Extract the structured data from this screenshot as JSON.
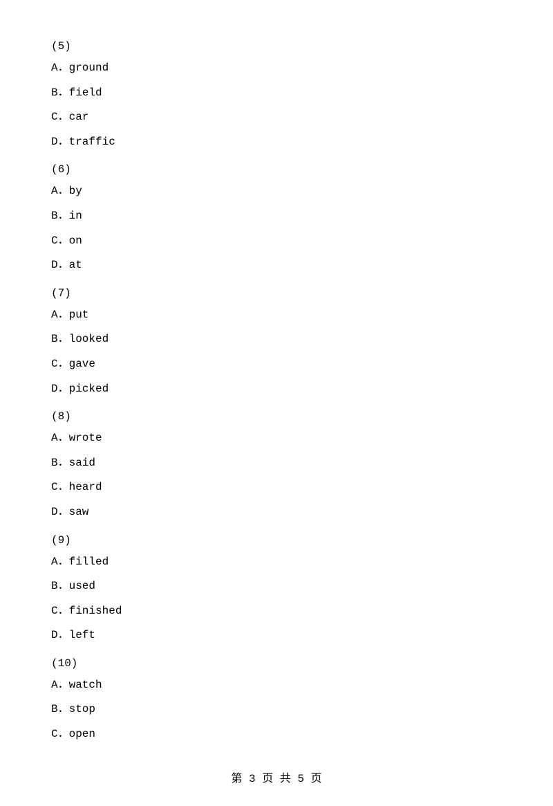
{
  "questions": [
    {
      "number": "(5)",
      "options": [
        {
          "label": "A．ground"
        },
        {
          "label": "B．field"
        },
        {
          "label": "C．car"
        },
        {
          "label": "D．traffic"
        }
      ]
    },
    {
      "number": "(6)",
      "options": [
        {
          "label": "A．by"
        },
        {
          "label": "B．in"
        },
        {
          "label": "C．on"
        },
        {
          "label": "D．at"
        }
      ]
    },
    {
      "number": "(7)",
      "options": [
        {
          "label": "A．put"
        },
        {
          "label": "B．looked"
        },
        {
          "label": "C．gave"
        },
        {
          "label": "D．picked"
        }
      ]
    },
    {
      "number": "(8)",
      "options": [
        {
          "label": "A．wrote"
        },
        {
          "label": "B．said"
        },
        {
          "label": "C．heard"
        },
        {
          "label": "D．saw"
        }
      ]
    },
    {
      "number": "(9)",
      "options": [
        {
          "label": "A．filled"
        },
        {
          "label": "B．used"
        },
        {
          "label": "C．finished"
        },
        {
          "label": "D．left"
        }
      ]
    },
    {
      "number": "(10)",
      "options": [
        {
          "label": "A．watch"
        },
        {
          "label": "B．stop"
        },
        {
          "label": "C．open"
        }
      ]
    }
  ],
  "footer": {
    "text": "第 3 页 共 5 页"
  }
}
